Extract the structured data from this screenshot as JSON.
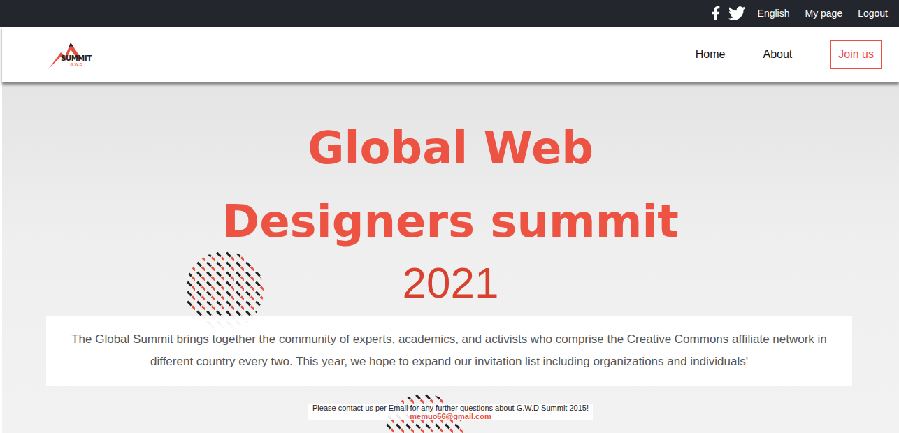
{
  "topbar": {
    "links": [
      {
        "label": "English"
      },
      {
        "label": "My page"
      },
      {
        "label": "Logout"
      }
    ]
  },
  "logo": {
    "title": "SUMMIT",
    "subtitle": "G.W.D"
  },
  "nav": {
    "items": [
      {
        "label": "Home"
      },
      {
        "label": "About"
      }
    ],
    "cta": "Join us"
  },
  "hero": {
    "title_lines": [
      "Global Web",
      "Designers summit"
    ],
    "year": "2021",
    "intro": "The Global Summit brings together the community of experts, academics, and activists who comprise the Creative Commons affiliate network in different country every two. This year, we hope to expand our invitation list including organizations and individuals'"
  },
  "footer": {
    "note": "Please contact us per Email for any further questions about G.W.D Summit 2015!",
    "email": "memuo56@gmail.com"
  }
}
